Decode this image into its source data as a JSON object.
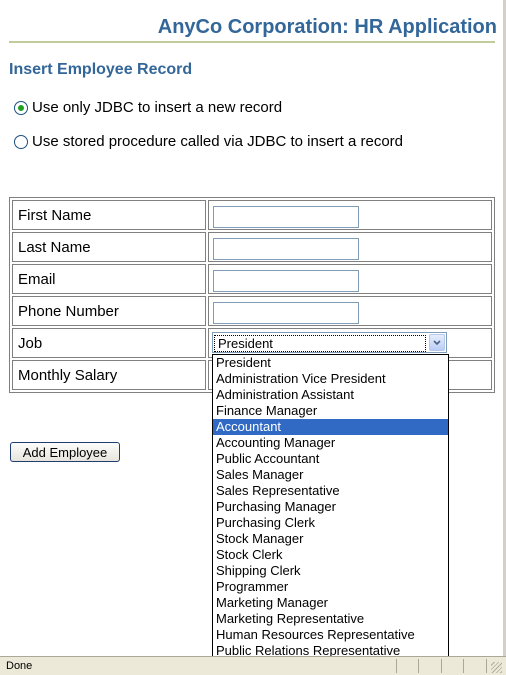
{
  "header": {
    "app_title": "AnyCo Corporation: HR Application",
    "section_title": "Insert Employee Record"
  },
  "insert_mode": {
    "options": [
      {
        "label": "Use only JDBC to insert a new record",
        "checked": true
      },
      {
        "label": "Use stored procedure called via JDBC to insert a record",
        "checked": false
      }
    ]
  },
  "form": {
    "fields": [
      {
        "label": "First Name",
        "value": ""
      },
      {
        "label": "Last Name",
        "value": ""
      },
      {
        "label": "Email",
        "value": ""
      },
      {
        "label": "Phone Number",
        "value": ""
      },
      {
        "label": "Job"
      },
      {
        "label": "Monthly Salary"
      }
    ],
    "job_select": {
      "selected": "President",
      "highlighted": "Accountant",
      "options": [
        "President",
        "Administration Vice President",
        "Administration Assistant",
        "Finance Manager",
        "Accountant",
        "Accounting Manager",
        "Public Accountant",
        "Sales Manager",
        "Sales Representative",
        "Purchasing Manager",
        "Purchasing Clerk",
        "Stock Manager",
        "Stock Clerk",
        "Shipping Clerk",
        "Programmer",
        "Marketing Manager",
        "Marketing Representative",
        "Human Resources Representative",
        "Public Relations Representative"
      ]
    },
    "submit_label": "Add Employee"
  },
  "status_bar": {
    "text": "Done"
  },
  "colors": {
    "title": "#336699",
    "highlight": "#316ac5"
  }
}
